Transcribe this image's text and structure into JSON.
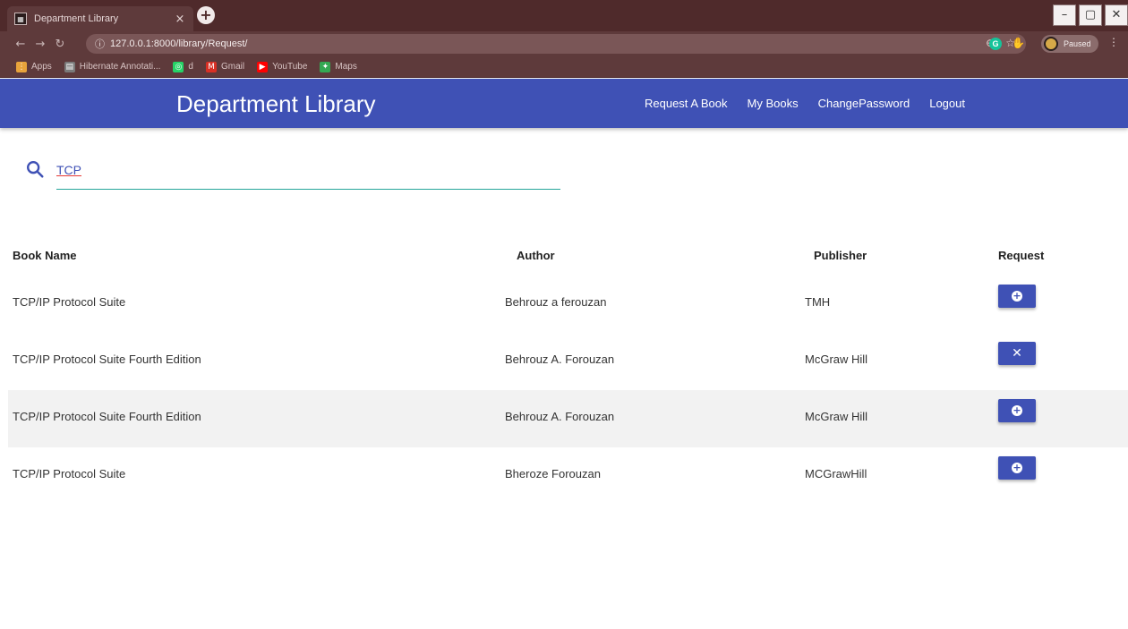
{
  "browser": {
    "tab_title": "Department Library",
    "tab_close": "×",
    "new_tab": "+",
    "url": "127.0.0.1:8000/library/Request/",
    "profile_label": "Paused",
    "win_minimize": "–",
    "win_restore": "▢",
    "win_close": "✕",
    "bookmarks": [
      {
        "label": "Apps",
        "icon": "apps-grid-icon",
        "color": "#e8a33b"
      },
      {
        "label": "Hibernate Annotati...",
        "icon": "page-icon",
        "color": "#7a7a7a"
      },
      {
        "label": "d",
        "icon": "whatsapp-icon",
        "color": "#25d366"
      },
      {
        "label": "Gmail",
        "icon": "gmail-icon",
        "color": "#d93025"
      },
      {
        "label": "YouTube",
        "icon": "youtube-icon",
        "color": "#ff0000"
      },
      {
        "label": "Maps",
        "icon": "maps-icon",
        "color": "#34a853"
      }
    ]
  },
  "navbar": {
    "brand": "Department Library",
    "links": [
      "Request A Book",
      "My Books",
      "ChangePassword",
      "Logout"
    ],
    "color": "#3f51b5"
  },
  "search": {
    "value": "TCP",
    "underline_color": "#26a69a"
  },
  "table": {
    "headers": [
      "Book Name",
      "Author",
      "Publisher",
      "Request"
    ],
    "rows": [
      {
        "name": "TCP/IP Protocol Suite",
        "author": "Behrouz a ferouzan",
        "publisher": "TMH",
        "action": "add-circle-icon"
      },
      {
        "name": "TCP/IP Protocol Suite Fourth Edition",
        "author": "Behrouz A. Forouzan",
        "publisher": "McGraw Hill",
        "action": "close-icon"
      },
      {
        "name": "TCP/IP Protocol Suite Fourth Edition",
        "author": "Behrouz A. Forouzan",
        "publisher": "McGraw Hill",
        "action": "add-circle-icon"
      },
      {
        "name": "TCP/IP Protocol Suite",
        "author": "Bheroze Forouzan",
        "publisher": "MCGrawHill",
        "action": "add-circle-icon"
      }
    ]
  }
}
